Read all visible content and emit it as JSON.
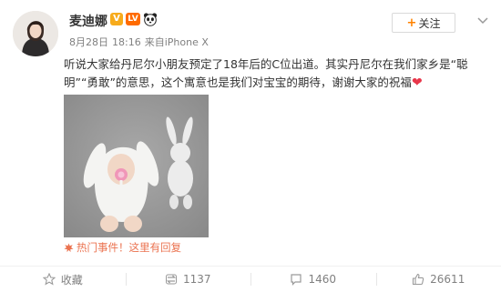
{
  "post": {
    "username": "麦迪娜",
    "badges": {
      "verified": "V",
      "level": "LV"
    },
    "meta": {
      "date": "8月28日",
      "time": "18:16",
      "source_prefix": "来自",
      "source": "iPhone X"
    },
    "follow_label": "关注",
    "text_line1": "听说大家给丹尼尔小朋友预定了18年后的C位出道。其实丹尼尔在我们家乡是“聪",
    "text_line2": "明”“勇敢”的意思，这个寓意也是我们对宝宝的期待，谢谢大家的祝福",
    "hot_topic": "热门事件！这里有回复",
    "actions": {
      "favorite": "收藏",
      "repost": "1137",
      "comment": "1460",
      "like": "26611"
    }
  },
  "colors": {
    "accent": "#ff8200",
    "hot_topic": "#eb7350",
    "heart": "#e8364a"
  },
  "icons": {
    "avatar": "user-avatar",
    "verified": "verified-v-badge",
    "level": "level-badge",
    "panda": "panda-icon",
    "chevron": "chevron-down-icon",
    "hot": "fire-icon",
    "favorite": "star-icon",
    "repost": "repost-icon",
    "comment": "comment-icon",
    "like": "thumbs-up-icon"
  }
}
